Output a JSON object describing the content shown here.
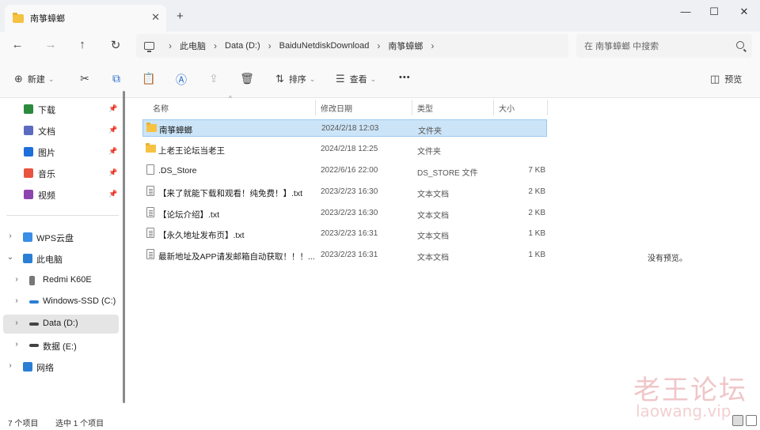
{
  "window": {
    "tab_title": "南箏蟑螂",
    "close_tab": "✕",
    "new_tab": "+",
    "minimize": "—",
    "maximize": "☐",
    "close": "✕"
  },
  "nav": {
    "back": "←",
    "forward": "→",
    "up": "↑",
    "refresh": "↻",
    "breadcrumbs": [
      "此电脑",
      "Data (D:)",
      "BaiduNetdiskDownload",
      "南箏蟑螂"
    ],
    "search_placeholder": "在 南箏蟑螂 中搜索"
  },
  "toolbar": {
    "new_label": "新建",
    "sort_label": "排序",
    "view_label": "查看",
    "more": "•••",
    "preview_label": "预览",
    "icons": {
      "new": "⊕",
      "cut": "✂",
      "copy": "⧉",
      "paste": "📋",
      "rename": "Ⓐ",
      "share": "⇪",
      "delete": "🗑",
      "sort": "⇅",
      "view": "☰",
      "caret": "⌄",
      "preview": "◫"
    }
  },
  "sidebar": {
    "pinned": [
      {
        "label": "下载",
        "icon": "download-icon",
        "color": "#2b8a3e"
      },
      {
        "label": "文档",
        "icon": "document-icon",
        "color": "#5c6bc0"
      },
      {
        "label": "图片",
        "icon": "pictures-icon",
        "color": "#1e6fd9"
      },
      {
        "label": "音乐",
        "icon": "music-icon",
        "color": "#e8543f"
      },
      {
        "label": "视频",
        "icon": "video-icon",
        "color": "#8e44ad"
      }
    ],
    "tree": [
      {
        "label": "WPS云盘",
        "icon": "cloud-icon",
        "color": "#3a8ee6"
      },
      {
        "label": "此电脑",
        "icon": "computer-icon",
        "color": "#2a7fd4"
      },
      {
        "label": "Redmi K60E",
        "icon": "phone-icon",
        "color": "#777777"
      },
      {
        "label": "Windows-SSD (C:)",
        "icon": "drive-icon",
        "color": "#2a7fd4"
      },
      {
        "label": "Data (D:)",
        "icon": "drive-icon",
        "color": "#444444"
      },
      {
        "label": "数据 (E:)",
        "icon": "drive-icon",
        "color": "#444444"
      },
      {
        "label": "网络",
        "icon": "network-icon",
        "color": "#2a7fd4"
      }
    ],
    "pin_glyph": "📌",
    "chevron_right": "›",
    "chevron_down": "⌄"
  },
  "columns": {
    "name": "名称",
    "date": "修改日期",
    "type": "类型",
    "size": "大小",
    "sort_indicator": "^"
  },
  "files": [
    {
      "name": "南箏蟑螂",
      "date": "2024/2/18 12:03",
      "type": "文件夹",
      "size": "",
      "kind": "folder"
    },
    {
      "name": "上老王论坛当老王",
      "date": "2024/2/18 12:25",
      "type": "文件夹",
      "size": "",
      "kind": "folder"
    },
    {
      "name": ".DS_Store",
      "date": "2022/6/16 22:00",
      "type": "DS_STORE 文件",
      "size": "7 KB",
      "kind": "file"
    },
    {
      "name": "【来了就能下载和观看！纯免费！】.txt",
      "date": "2023/2/23 16:30",
      "type": "文本文档",
      "size": "2 KB",
      "kind": "txt"
    },
    {
      "name": "【论坛介绍】.txt",
      "date": "2023/2/23 16:30",
      "type": "文本文档",
      "size": "2 KB",
      "kind": "txt"
    },
    {
      "name": "【永久地址发布页】.txt",
      "date": "2023/2/23 16:31",
      "type": "文本文档",
      "size": "1 KB",
      "kind": "txt"
    },
    {
      "name": "最新地址及APP请发邮箱自动获取！！！...",
      "date": "2023/2/23 16:31",
      "type": "文本文档",
      "size": "1 KB",
      "kind": "txt"
    }
  ],
  "preview": {
    "empty_text": "没有预览。"
  },
  "status": {
    "item_count": "7 个项目",
    "selected": "选中 1 个项目"
  },
  "watermark": {
    "cn": "老王论坛",
    "en": "laowang.vip"
  },
  "colors": {
    "selection": "#cce4f7",
    "folder": "#f5c242",
    "accent": "#2a6fc9"
  }
}
